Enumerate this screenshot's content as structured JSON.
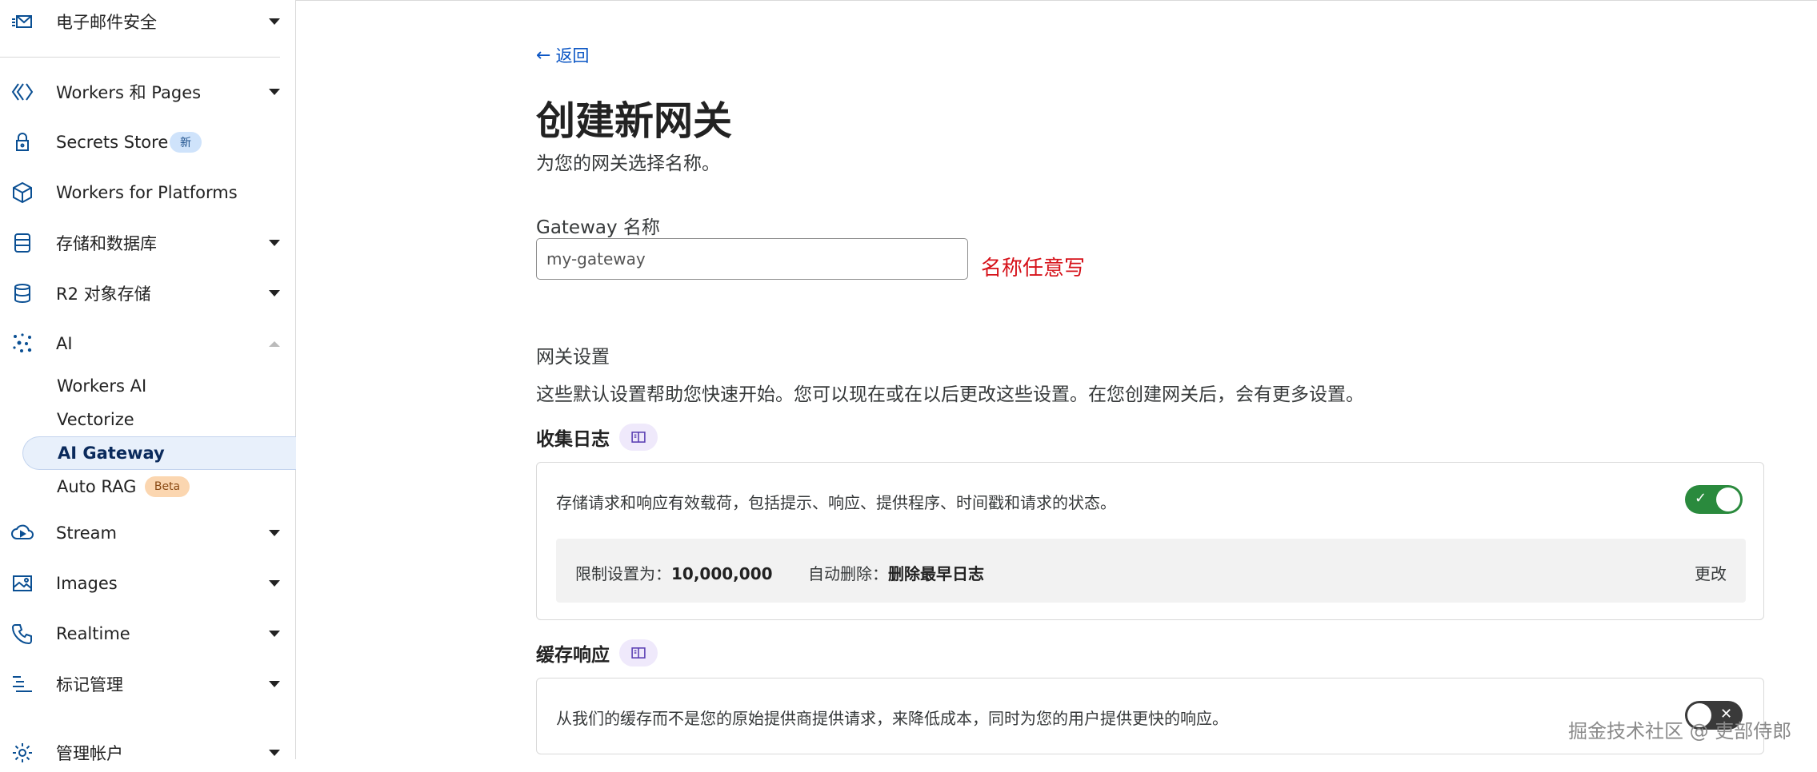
{
  "sidebar": {
    "items": [
      {
        "label": "电子邮件安全",
        "icon": "mail-icon"
      },
      {
        "label": "Workers 和 Pages",
        "icon": "workers-icon"
      },
      {
        "label": "Secrets Store",
        "icon": "lock-icon",
        "badge": "新"
      },
      {
        "label": "Workers for Platforms",
        "icon": "cube-icon"
      },
      {
        "label": "存储和数据库",
        "icon": "database-icon"
      },
      {
        "label": "R2 对象存储",
        "icon": "storage-icon"
      },
      {
        "label": "AI",
        "icon": "sparkle-icon"
      },
      {
        "label": "Stream",
        "icon": "cloud-play-icon"
      },
      {
        "label": "Images",
        "icon": "image-icon"
      },
      {
        "label": "Realtime",
        "icon": "phone-icon"
      },
      {
        "label": "标记管理",
        "icon": "tag-list-icon"
      },
      {
        "label": "管理帐户",
        "icon": "gear-icon"
      }
    ],
    "ai_sub": [
      {
        "label": "Workers AI"
      },
      {
        "label": "Vectorize"
      },
      {
        "label": "AI Gateway",
        "active": true
      },
      {
        "label": "Auto RAG",
        "badge": "Beta"
      }
    ]
  },
  "main": {
    "back_label": "返回",
    "title": "创建新网关",
    "subtitle": "为您的网关选择名称。",
    "field_label": "Gateway 名称",
    "field_value": "my-gateway",
    "annotation": "名称任意写",
    "settings_title": "网关设置",
    "settings_desc": "这些默认设置帮助您快速开始。您可以现在或在以后更改这些设置。在您创建网关后，会有更多设置。",
    "logs": {
      "title": "收集日志",
      "desc": "存储请求和响应有效载荷，包括提示、响应、提供程序、时间戳和请求的状态。",
      "enabled": true,
      "limit_label": "限制设置为：",
      "limit_value": "10,000,000",
      "auto_delete_label": "自动删除：",
      "auto_delete_value": "删除最早日志",
      "change_label": "更改"
    },
    "cache": {
      "title": "缓存响应",
      "desc": "从我们的缓存而不是您的原始提供商提供请求，来降低成本，同时为您的用户提供更快的响应。",
      "enabled": false
    }
  },
  "watermark": "掘金技术社区 @ 吏部侍郎"
}
